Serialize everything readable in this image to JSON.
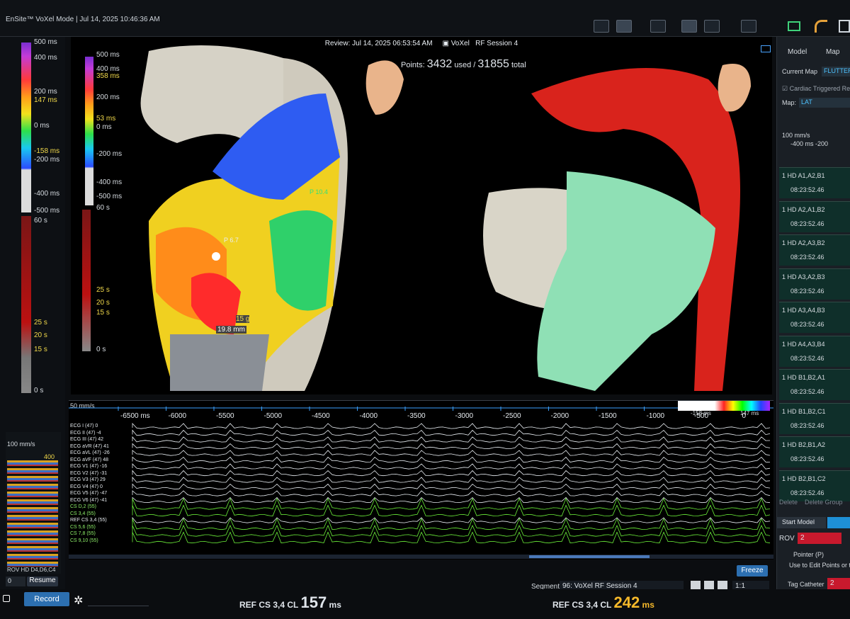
{
  "title": {
    "app": "EnSite™ VoXel Mode |",
    "date": "Jul 14, 2025 10:46:36 AM"
  },
  "map": {
    "review": "Review: Jul 14, 2025 06:53:54 AM",
    "mode": "VoXel",
    "session": "RF Session 4",
    "points_label": "Points:",
    "points_used": "3432",
    "used_label": "used /",
    "points_total": "31855",
    "total_label": "total",
    "p_label_1": "P 10.4",
    "p_label_2": "P 6.7",
    "force": "15 g",
    "distance": "19.8 mm"
  },
  "scale_left": {
    "ticks": [
      "500 ms",
      "400 ms",
      "200 ms",
      "147 ms",
      "0 ms",
      "-158 ms",
      "-200 ms",
      "-400 ms",
      "-500 ms",
      "60 s",
      "25 s",
      "20 s",
      "15 s",
      "0 s"
    ]
  },
  "scale_mid": {
    "ticks": [
      "500 ms",
      "400 ms",
      "358 ms",
      "200 ms",
      "53 ms",
      "0 ms",
      "-200 ms",
      "-400 ms",
      "-500 ms",
      "60 s",
      "25 s",
      "20 s",
      "15 s",
      "0 s"
    ]
  },
  "wave": {
    "speed": "50 mm/s",
    "axis": [
      "-6500 ms",
      "-6000",
      "-5500",
      "-5000",
      "-4500",
      "-4000",
      "-3500",
      "-3000",
      "-2500",
      "-2000",
      "-1500",
      "-1000",
      "-500",
      "0"
    ],
    "channels": [
      "ECG I (47) 0",
      "ECG II (47) -4",
      "ECG III (47) 42",
      "ECG aVR (47) 41",
      "ECG aVL (47) -26",
      "ECG aVF (47) 48",
      "ECG V1 (47) -16",
      "ECG V2 (47) -31",
      "ECG V3 (47) 29",
      "ECG V4 (47) 0",
      "ECG V5 (47) -47",
      "ECG V6 (47) -41",
      "CS D,2 (55)",
      "CS 3,4 (55)",
      "REF CS 3,4 (55)",
      "CS 5,6 (55)",
      "CS 7,8 (55)",
      "CS 9,10 (55)"
    ],
    "mini_labels": [
      "-158 ms",
      "147 ms"
    ],
    "freeze": "Freeze",
    "segment_label": "Segment",
    "segment": "96: VoXel RF Session 4",
    "ratio": "1:1"
  },
  "right": {
    "tabs": [
      "Model",
      "Map"
    ],
    "current_map_label": "Current Map",
    "current_map": "FLUTTER",
    "cardiac": "Cardiac Triggered Re",
    "map_label": "Map:",
    "map_value": "LAT",
    "speed": "100 mm/s",
    "range": "-400 ms  -200",
    "rows": [
      {
        "name": "1 HD  A1,A2,B1",
        "time": "08:23:52.46"
      },
      {
        "name": "1 HD  A2,A1,B2",
        "time": "08:23:52.46"
      },
      {
        "name": "1 HD  A2,A3,B2",
        "time": "08:23:52.46"
      },
      {
        "name": "1 HD  A3,A2,B3",
        "time": "08:23:52.46"
      },
      {
        "name": "1 HD  A3,A4,B3",
        "time": "08:23:52.46"
      },
      {
        "name": "1 HD  A4,A3,B4",
        "time": "08:23:52.46"
      },
      {
        "name": "1 HD  B1,B2,A1",
        "time": "08:23:52.46"
      },
      {
        "name": "1 HD  B1,B2,C1",
        "time": "08:23:52.46"
      },
      {
        "name": "1 HD  B2,B1,A2",
        "time": "08:23:52.46"
      },
      {
        "name": "1 HD  B2,B1,C2",
        "time": "08:23:52.46"
      }
    ],
    "delete": "Delete",
    "delete_group": "Delete Group",
    "start_model": "Start Model",
    "rov": "ROV",
    "rov_value": "2",
    "pointer": "Pointer (P)",
    "hint": "Use to Edit Points or t",
    "tag": "Tag Catheter",
    "tag_value": "2"
  },
  "left_bottom": {
    "speed": "100 mm/s",
    "rov": "ROV HD",
    "code": "D4,D6,C4",
    "zero": "0",
    "resume": "Resume",
    "record": "Record",
    "v400": "400"
  },
  "bottom": {
    "ref1_label": "REF CS 3,4 CL",
    "ref1_value": "157",
    "ref1_unit": "ms",
    "ref2_label": "REF CS 3,4 CL",
    "ref2_value": "242",
    "ref2_unit": "ms"
  }
}
